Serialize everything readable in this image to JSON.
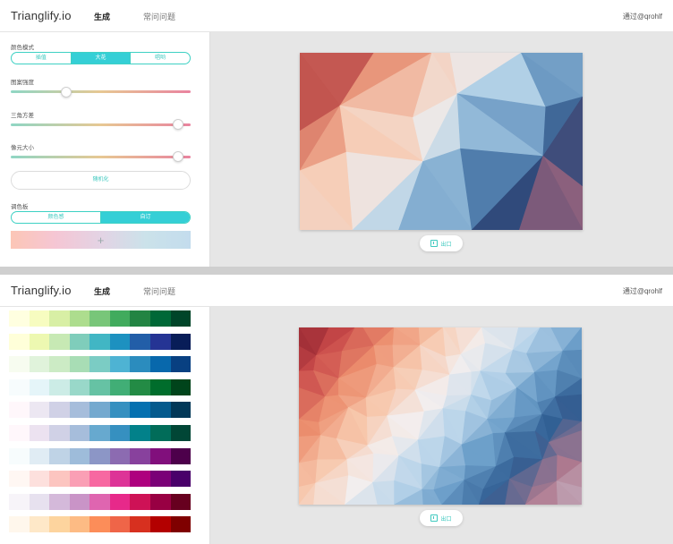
{
  "app": {
    "brand": "Trianglify.io",
    "nav": {
      "generate": "生成",
      "faq": "常问问题"
    },
    "via": "通过@qrohlf"
  },
  "panel1": {
    "color_mode": {
      "label": "颜色模式",
      "options": [
        "插值",
        "大花",
        "唱哟"
      ],
      "selected": 1
    },
    "sliders": [
      {
        "label": "图案强度",
        "value": 0.31
      },
      {
        "label": "三角方差",
        "value": 0.93
      },
      {
        "label": "像元大小",
        "value": 0.93
      }
    ],
    "randomize_label": "随机化",
    "palette": {
      "label": "调色板",
      "tabs": [
        "颜色感",
        "自订"
      ],
      "selected": 1,
      "add_glyph": "+"
    },
    "export_label": "出口"
  },
  "panel2": {
    "export_label": "出口",
    "swatch_rows": [
      [
        "#ffffe0",
        "#f7fcc0",
        "#d8efa5",
        "#addd8e",
        "#78c679",
        "#41ab5d",
        "#238443",
        "#006837",
        "#004529"
      ],
      [
        "#ffffd9",
        "#edf8b1",
        "#c7e9b4",
        "#7fcdbb",
        "#41b6c4",
        "#1d91c0",
        "#225ea8",
        "#253494",
        "#081d58"
      ],
      [
        "#f7fcf0",
        "#e0f3db",
        "#ccebc5",
        "#a8ddb5",
        "#7bccc4",
        "#4eb3d3",
        "#2b8cbe",
        "#0868ac",
        "#084081"
      ],
      [
        "#f7fcfd",
        "#e5f5f9",
        "#ccece6",
        "#99d8c9",
        "#66c2a4",
        "#41ae76",
        "#238b45",
        "#006d2c",
        "#00441b"
      ],
      [
        "#fff7fb",
        "#ece7f2",
        "#d0d1e6",
        "#a6bddb",
        "#74a9cf",
        "#3690c0",
        "#0570b0",
        "#045a8d",
        "#023858"
      ],
      [
        "#fff7fb",
        "#ece2f0",
        "#d0d1e6",
        "#a6bddb",
        "#67a9cf",
        "#3690c0",
        "#02818a",
        "#016c59",
        "#014636"
      ],
      [
        "#f7fcfd",
        "#e0ecf4",
        "#bfd3e6",
        "#9ebcda",
        "#8c96c6",
        "#8c6bb1",
        "#88419d",
        "#810f7c",
        "#4d004b"
      ],
      [
        "#fff7f3",
        "#fde0dd",
        "#fcc5c0",
        "#fa9fb5",
        "#f768a1",
        "#dd3497",
        "#ae017e",
        "#7a0177",
        "#49006a"
      ],
      [
        "#f7f4f9",
        "#e7e1ef",
        "#d4b9da",
        "#c994c7",
        "#df65b0",
        "#e7298a",
        "#ce1256",
        "#980043",
        "#67001f"
      ],
      [
        "#fff7ec",
        "#fee8c8",
        "#fdd49e",
        "#fdbb84",
        "#fc8d59",
        "#ef6548",
        "#d7301f",
        "#b30000",
        "#7f0000"
      ]
    ]
  },
  "colors": {
    "accent": "#35cfd6",
    "accent_text": "#3ec9bf",
    "canvas_bg": "#e6e6e6",
    "art1": [
      "#6b1a2a",
      "#c0514d",
      "#e8957a",
      "#f6cdb7",
      "#ece8e8",
      "#a9cde6",
      "#5a8ab8",
      "#27487b",
      "#8a5d7a",
      "#b6b7c8"
    ],
    "art2": [
      "#8a1f2c",
      "#c94a4a",
      "#ec8e6e",
      "#f7c7ac",
      "#f3eeee",
      "#b8d4ea",
      "#6b9ec9",
      "#2f5d92",
      "#b07a8f",
      "#c7b7c7"
    ]
  },
  "icons": {
    "export": "export-icon",
    "add": "plus-icon"
  }
}
